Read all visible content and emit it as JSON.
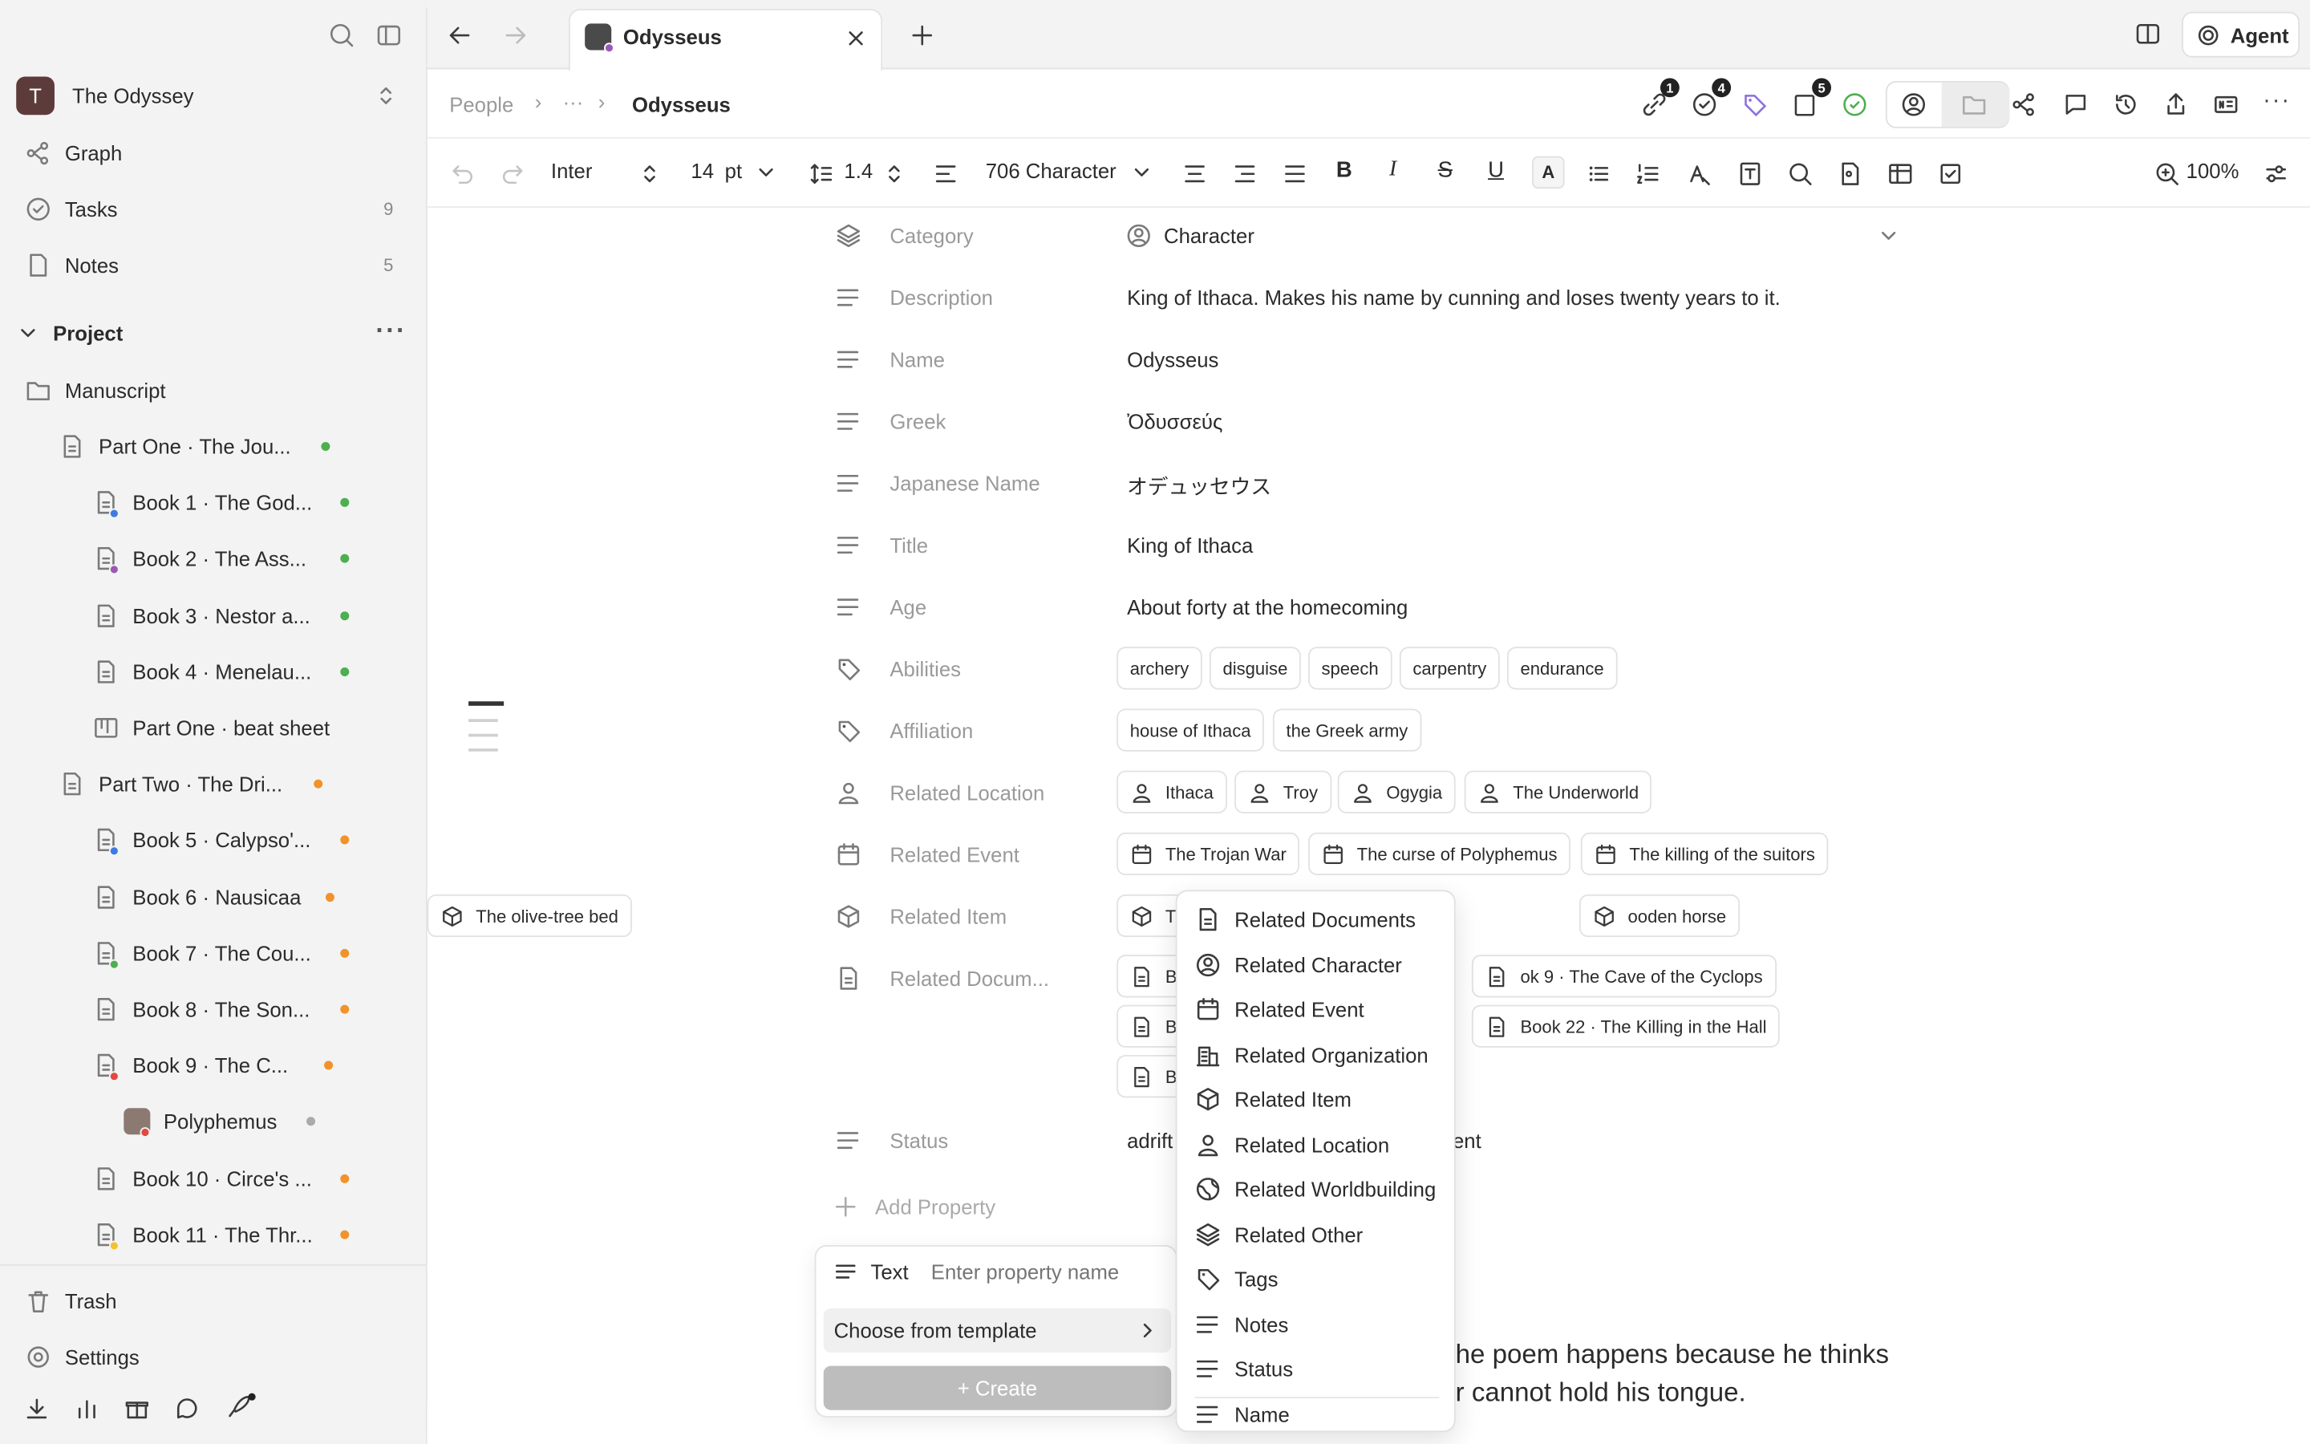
{
  "sidebar": {
    "workspace_initial": "T",
    "workspace_name": "The Odyssey",
    "nav": [
      {
        "label": "Graph",
        "count": ""
      },
      {
        "label": "Tasks",
        "count": "9"
      },
      {
        "label": "Notes",
        "count": "5"
      }
    ],
    "section_label": "Project",
    "tree": [
      {
        "label": "Manuscript"
      },
      {
        "label": "Part One · The Jou..."
      },
      {
        "label": "Book 1 · The God..."
      },
      {
        "label": "Book 2 · The Ass..."
      },
      {
        "label": "Book 3 · Nestor a..."
      },
      {
        "label": "Book 4 · Menelau..."
      },
      {
        "label": "Part One · beat sheet"
      },
      {
        "label": "Part Two · The Dri..."
      },
      {
        "label": "Book 5 · Calypso'..."
      },
      {
        "label": "Book 6 · Nausicaa"
      },
      {
        "label": "Book 7 · The Cou..."
      },
      {
        "label": "Book 8 · The Son..."
      },
      {
        "label": "Book 9 · The C..."
      },
      {
        "label": "Polyphemus"
      },
      {
        "label": "Book 10 · Circe's ..."
      },
      {
        "label": "Book 11 · The Thr..."
      }
    ],
    "trash_label": "Trash",
    "settings_label": "Settings"
  },
  "tabs": {
    "active_tab": "Odysseus",
    "agent_label": "Agent"
  },
  "breadcrumb": {
    "root": "People",
    "ellipsis": "···",
    "current": "Odysseus",
    "badges": {
      "links": "1",
      "tasks": "4",
      "docs": "5"
    }
  },
  "toolbar": {
    "font": "Inter",
    "size": "14",
    "size_unit": "pt",
    "line_height": "1.4",
    "style": "706 Character",
    "zoom": "100%"
  },
  "properties": [
    {
      "label": "Category",
      "value": "Character"
    },
    {
      "label": "Description",
      "value": "King of Ithaca. Makes his name by cunning and loses twenty years to it."
    },
    {
      "label": "Name",
      "value": "Odysseus"
    },
    {
      "label": "Greek",
      "value": "Ὀδυσσεύς"
    },
    {
      "label": "Japanese Name",
      "value": "オデュッセウス"
    },
    {
      "label": "Title",
      "value": "King of Ithaca"
    },
    {
      "label": "Age",
      "value": "About forty at the homecoming"
    },
    {
      "label": "Abilities",
      "chips": [
        "archery",
        "disguise",
        "speech",
        "carpentry",
        "endurance"
      ]
    },
    {
      "label": "Affiliation",
      "chips": [
        "house of Ithaca",
        "the Greek army"
      ]
    },
    {
      "label": "Related Location",
      "chips": [
        "Ithaca",
        "Troy",
        "Ogygia",
        "The Underworld"
      ]
    },
    {
      "label": "Related Event",
      "chips": [
        "The Trojan War",
        "The curse of Polyphemus",
        "The killing of the suitors"
      ]
    },
    {
      "label": "Related Item",
      "chips": [
        "T",
        "ooden horse",
        "The olive-tree bed"
      ]
    },
    {
      "label": "Related Docum...",
      "chips": [
        "B",
        "ok 9 · The Cave of the Cyclops",
        "B",
        "Book 22 · The Killing in the Hall",
        "B"
      ]
    },
    {
      "label": "Status",
      "value": "adrift",
      "value_tail": "ent"
    }
  ],
  "add_property_label": "Add Property",
  "add_panel": {
    "type_label": "Text",
    "name_placeholder": "Enter property name",
    "template_label": "Choose from template",
    "create_label": "+ Create"
  },
  "menu": {
    "items": [
      {
        "label": "Related Documents",
        "icon": "document-icon"
      },
      {
        "label": "Related Character",
        "icon": "person-icon"
      },
      {
        "label": "Related Event",
        "icon": "calendar-icon"
      },
      {
        "label": "Related Organization",
        "icon": "building-icon"
      },
      {
        "label": "Related Item",
        "icon": "box-icon"
      },
      {
        "label": "Related Location",
        "icon": "location-person-icon"
      },
      {
        "label": "Related Worldbuilding",
        "icon": "globe-icon"
      },
      {
        "label": "Related Other",
        "icon": "layers-icon"
      },
      {
        "label": "Tags",
        "icon": "tag-icon"
      },
      {
        "label": "Notes",
        "icon": "lines-icon"
      },
      {
        "label": "Status",
        "icon": "lines-icon"
      },
      {
        "label": "Name",
        "icon": "lines-icon"
      }
    ]
  },
  "body_text": {
    "line1": "he poem happens because he thinks",
    "line2": "r cannot hold his tongue."
  },
  "colors": {
    "green": "#4caf50",
    "orange": "#f0932b",
    "purple": "#9b59b6",
    "blue": "#3f7be0",
    "red": "#e04a3f",
    "yellow": "#f2c230",
    "avatar": "#5e3b3b"
  }
}
